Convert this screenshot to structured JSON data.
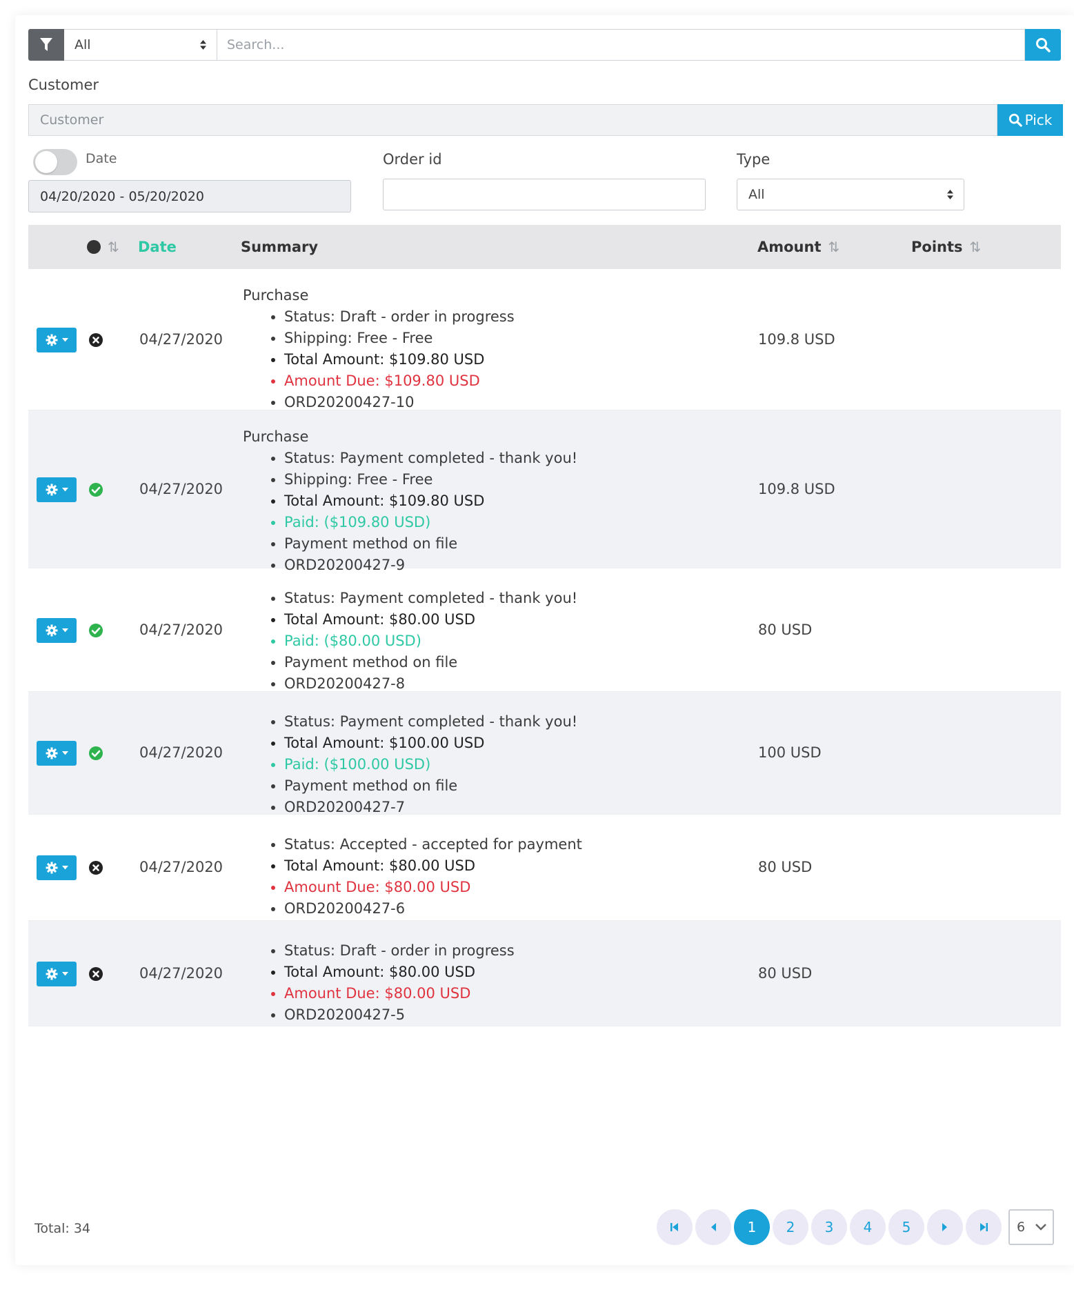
{
  "search_bar": {
    "filter_type_value": "All",
    "search_placeholder": "Search..."
  },
  "customer": {
    "label": "Customer",
    "placeholder": "Customer",
    "pick_label": "Pick"
  },
  "date_filter": {
    "label": "Date",
    "range": "04/20/2020 - 05/20/2020",
    "toggle_on": false
  },
  "order_id": {
    "label": "Order id",
    "value": ""
  },
  "type_filter": {
    "label": "Type",
    "value": "All"
  },
  "table": {
    "columns": {
      "date": "Date",
      "summary": "Summary",
      "amount": "Amount",
      "points": "Points"
    },
    "rows": [
      {
        "status": "error",
        "date": "04/27/2020",
        "kind": "Purchase",
        "items": [
          {
            "text": "Status: Draft - order in progress",
            "tone": "normal"
          },
          {
            "text": "Shipping: Free - Free",
            "tone": "normal"
          },
          {
            "text": "Total Amount: $109.80 USD",
            "tone": "dark"
          },
          {
            "text": "Amount Due: $109.80 USD",
            "tone": "red"
          },
          {
            "text": "ORD20200427-10",
            "tone": "normal"
          }
        ],
        "amount": "109.8 USD",
        "points": ""
      },
      {
        "status": "ok",
        "date": "04/27/2020",
        "kind": "Purchase",
        "items": [
          {
            "text": "Status: Payment completed - thank you!",
            "tone": "normal"
          },
          {
            "text": "Shipping: Free - Free",
            "tone": "normal"
          },
          {
            "text": "Total Amount: $109.80 USD",
            "tone": "dark"
          },
          {
            "text": "Paid: ($109.80 USD)",
            "tone": "green"
          },
          {
            "text": "Payment method on file",
            "tone": "normal"
          },
          {
            "text": "ORD20200427-9",
            "tone": "normal"
          }
        ],
        "amount": "109.8 USD",
        "points": ""
      },
      {
        "status": "ok",
        "date": "04/27/2020",
        "kind": "",
        "items": [
          {
            "text": "Status: Payment completed - thank you!",
            "tone": "normal"
          },
          {
            "text": "Total Amount: $80.00 USD",
            "tone": "dark"
          },
          {
            "text": "Paid: ($80.00 USD)",
            "tone": "green"
          },
          {
            "text": "Payment method on file",
            "tone": "normal"
          },
          {
            "text": "ORD20200427-8",
            "tone": "normal"
          }
        ],
        "amount": "80 USD",
        "points": ""
      },
      {
        "status": "ok",
        "date": "04/27/2020",
        "kind": "",
        "items": [
          {
            "text": "Status: Payment completed - thank you!",
            "tone": "normal"
          },
          {
            "text": "Total Amount: $100.00 USD",
            "tone": "dark"
          },
          {
            "text": "Paid: ($100.00 USD)",
            "tone": "green"
          },
          {
            "text": "Payment method on file",
            "tone": "normal"
          },
          {
            "text": "ORD20200427-7",
            "tone": "normal"
          }
        ],
        "amount": "100 USD",
        "points": ""
      },
      {
        "status": "error",
        "date": "04/27/2020",
        "kind": "",
        "items": [
          {
            "text": "Status: Accepted - accepted for payment",
            "tone": "normal"
          },
          {
            "text": "Total Amount: $80.00 USD",
            "tone": "dark"
          },
          {
            "text": "Amount Due: $80.00 USD",
            "tone": "red"
          },
          {
            "text": "ORD20200427-6",
            "tone": "normal"
          }
        ],
        "amount": "80 USD",
        "points": ""
      },
      {
        "status": "error",
        "date": "04/27/2020",
        "kind": "",
        "items": [
          {
            "text": "Status: Draft - order in progress",
            "tone": "normal"
          },
          {
            "text": "Total Amount: $80.00 USD",
            "tone": "dark"
          },
          {
            "text": "Amount Due: $80.00 USD",
            "tone": "red"
          },
          {
            "text": "ORD20200427-5",
            "tone": "normal"
          }
        ],
        "amount": "80 USD",
        "points": ""
      }
    ]
  },
  "footer": {
    "total": "Total: 34",
    "pages": [
      "1",
      "2",
      "3",
      "4",
      "5"
    ],
    "current_page": "1",
    "page_size": "6"
  },
  "colors": {
    "accent": "#1aa3d9",
    "success": "#2eb34e",
    "danger": "#e03340",
    "paid": "#2ec9a4",
    "sorted_header": "#2ec9a4"
  }
}
